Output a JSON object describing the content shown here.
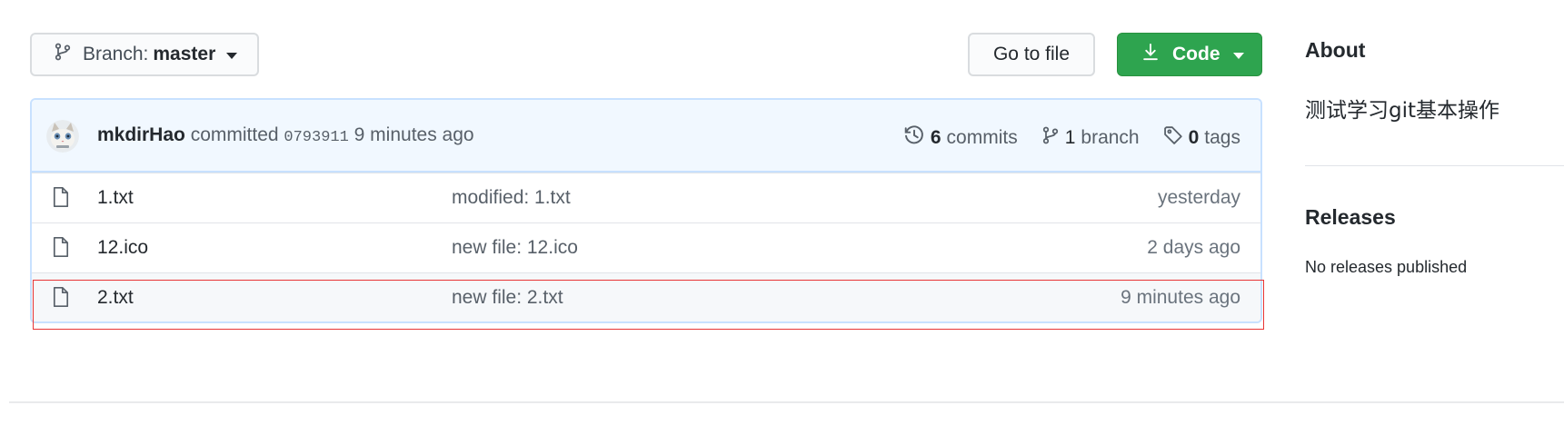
{
  "toolbar": {
    "branch_prefix": "Branch:",
    "branch_name": "master",
    "goto_file_label": "Go to file",
    "code_label": "Code"
  },
  "commit": {
    "author": "mkdirHao",
    "verb": "committed",
    "sha": "0793911",
    "time": "9 minutes ago"
  },
  "stats": {
    "commits": {
      "count": "6",
      "label": "commits"
    },
    "branches": {
      "count": "1",
      "label": "branch"
    },
    "tags": {
      "count": "0",
      "label": "tags"
    }
  },
  "files": [
    {
      "name": "1.txt",
      "message": "modified: 1.txt",
      "age": "yesterday"
    },
    {
      "name": "12.ico",
      "message": "new file: 12.ico",
      "age": "2 days ago"
    },
    {
      "name": "2.txt",
      "message": "new file: 2.txt",
      "age": "9 minutes ago"
    }
  ],
  "sidebar": {
    "about_heading": "About",
    "description": "测试学习git基本操作",
    "releases_heading": "Releases",
    "no_releases": "No releases published"
  },
  "colors": {
    "code_button": "#2ea44f",
    "commit_header_bg": "#f1f8ff",
    "highlight_border": "#e83535"
  },
  "icons": {
    "branch": "git-branch-icon",
    "download": "download-icon",
    "history": "history-icon",
    "tag": "tag-icon",
    "file": "file-icon"
  }
}
